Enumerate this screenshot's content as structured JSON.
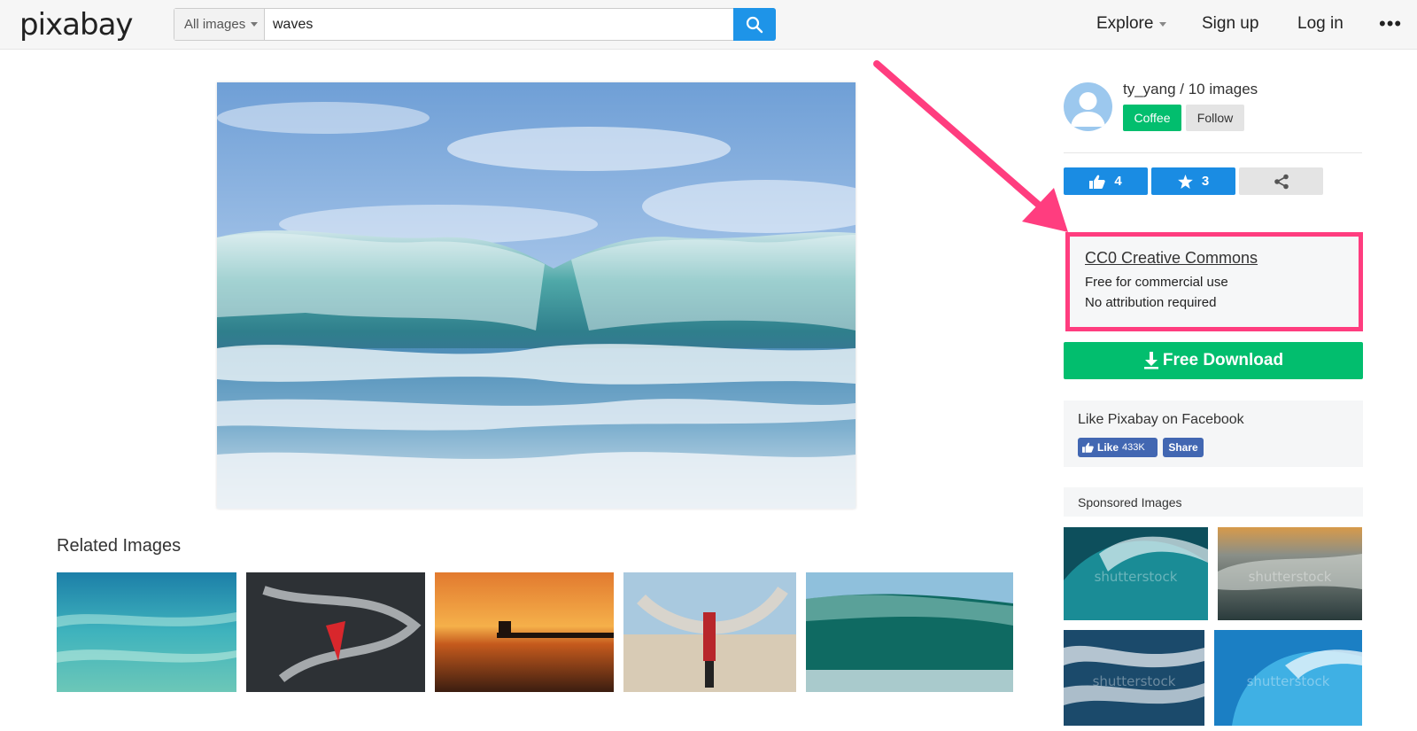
{
  "header": {
    "logo": "pixabay",
    "search_type": "All images",
    "search_value": "waves",
    "nav": {
      "explore": "Explore",
      "signup": "Sign up",
      "login": "Log in",
      "more": "•••"
    }
  },
  "main": {
    "related_title": "Related Images"
  },
  "sidebar": {
    "user_line": "ty_yang / 10 images",
    "coffee_label": "Coffee",
    "follow_label": "Follow",
    "likes": "4",
    "favorites": "3",
    "license": {
      "title": "CC0 Creative Commons",
      "line1": "Free for commercial use",
      "line2": "No attribution required"
    },
    "download_label": "Free Download",
    "facebook": {
      "text": "Like Pixabay on Facebook",
      "like_label": "Like",
      "like_count": "433K",
      "share_label": "Share"
    },
    "sponsored_title": "Sponsored Images",
    "watermark": "shutterstock"
  },
  "colors": {
    "accent_blue": "#1a8ce3",
    "accent_green": "#02be6e",
    "highlight_pink": "#ff3d7f",
    "facebook_blue": "#4267b2"
  }
}
